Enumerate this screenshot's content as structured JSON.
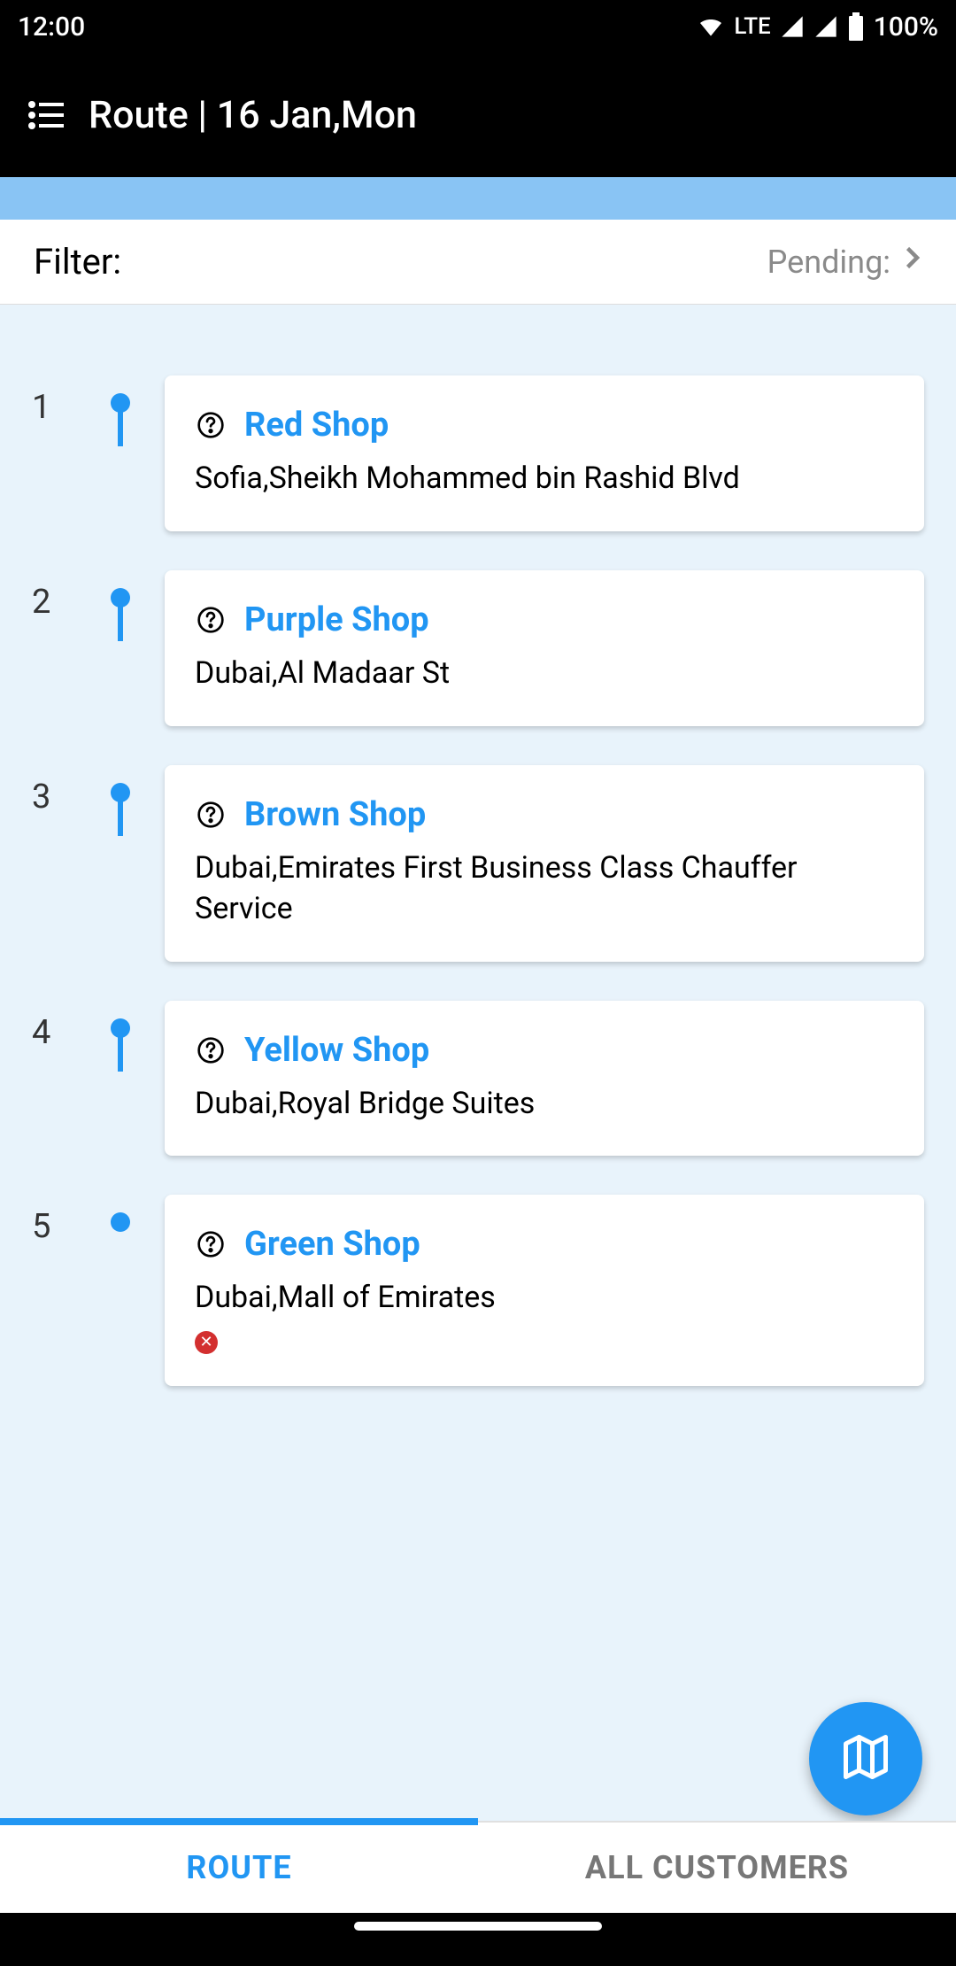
{
  "status": {
    "time": "12:00",
    "lte_label": "LTE",
    "battery_label": "100%"
  },
  "appbar": {
    "title": "Route | 16 Jan,Mon"
  },
  "filter": {
    "label": "Filter:",
    "pending_label": "Pending:"
  },
  "route": [
    {
      "index": "1",
      "name": "Red Shop",
      "address": "Sofia,Sheikh Mohammed bin Rashid Blvd",
      "has_error": false
    },
    {
      "index": "2",
      "name": "Purple Shop",
      "address": "Dubai,Al Madaar St",
      "has_error": false
    },
    {
      "index": "3",
      "name": "Brown Shop",
      "address": "Dubai,Emirates First Business Class Chauffer Service",
      "has_error": false
    },
    {
      "index": "4",
      "name": "Yellow Shop",
      "address": "Dubai,Royal Bridge Suites",
      "has_error": false
    },
    {
      "index": "5",
      "name": "Green Shop",
      "address": "Dubai,Mall of Emirates",
      "has_error": true
    }
  ],
  "tabs": {
    "route": "ROUTE",
    "all_customers": "ALL CUSTOMERS"
  },
  "colors": {
    "accent": "#2196f3",
    "light_blue": "#89c4f4",
    "list_bg": "#e8f3fb",
    "error": "#d32f2f"
  }
}
